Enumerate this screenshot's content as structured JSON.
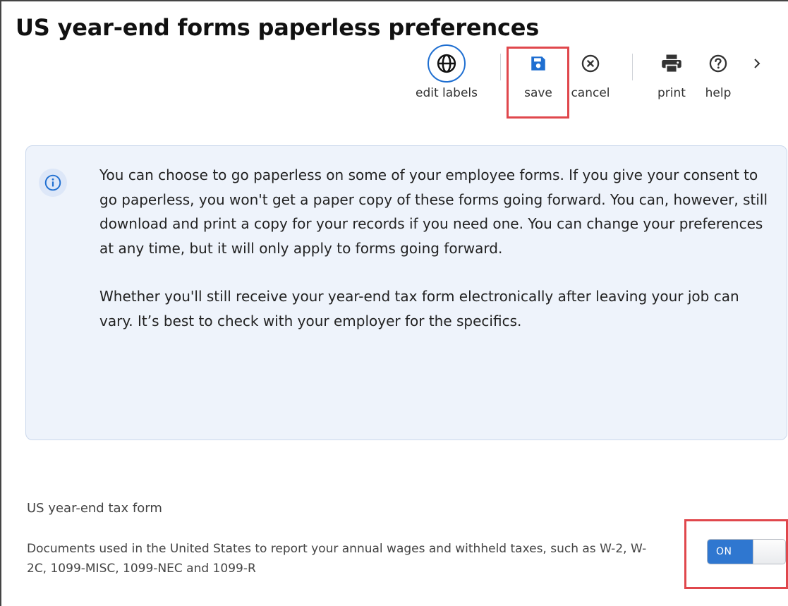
{
  "page": {
    "title": "US year-end forms paperless preferences"
  },
  "toolbar": {
    "edit_labels": {
      "label": "edit labels",
      "icon": "globe-icon"
    },
    "save": {
      "label": "save",
      "icon": "save-icon"
    },
    "cancel": {
      "label": "cancel",
      "icon": "cancel-icon"
    },
    "print": {
      "label": "print",
      "icon": "print-icon"
    },
    "help": {
      "label": "help",
      "icon": "help-icon"
    },
    "more": {
      "icon": "chevron-right-icon"
    }
  },
  "info": {
    "icon": "info-icon",
    "paragraph1": "You can choose to go paperless on some of your employee forms. If you give your consent to go paperless, you won't get a paper copy of these forms going forward. You can, however, still download and print a copy for your records if you need one. You can change your preferences at any time, but it will only apply to forms going forward.",
    "paragraph2": "Whether you'll still receive your year-end tax form electronically after leaving your job can vary. It’s best to check with your employer for the specifics."
  },
  "form": {
    "label": "US year-end tax form",
    "description": "Documents used in the United States to report your annual wages and withheld taxes, such as W-2, W-2C, 1099-MISC, 1099-NEC and 1099-R",
    "toggle": {
      "state_label": "ON",
      "checked": true
    }
  },
  "colors": {
    "accent": "#1f6fd1",
    "toggle_on": "#2f77d0",
    "highlight": "#e0474c",
    "info_bg": "#eef3fb"
  }
}
